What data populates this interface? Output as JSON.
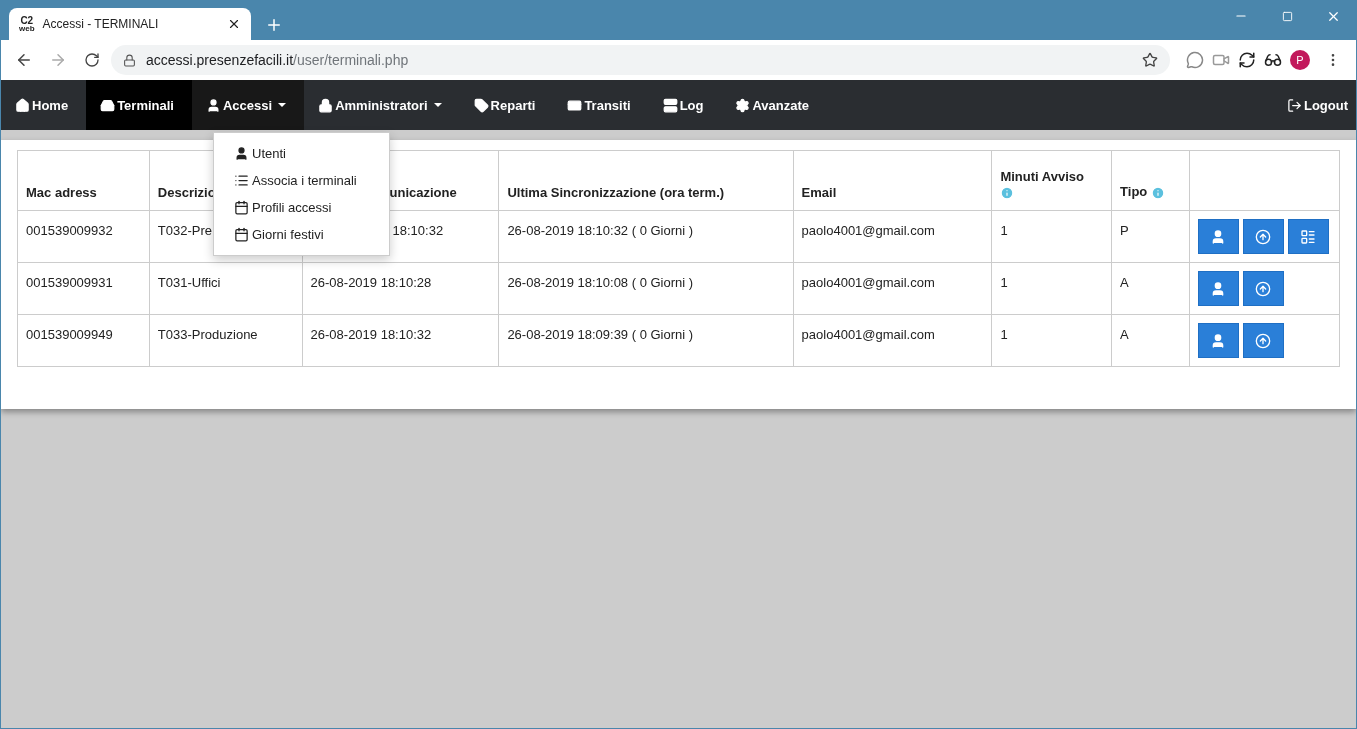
{
  "browser": {
    "tab_title": "Accessi - TERMINALI",
    "tab_logo": "C2",
    "tab_logo_sub": "web",
    "url_host": "accessi.presenzefacili.it",
    "url_path": "/user/terminali.php",
    "profile": "P"
  },
  "nav": {
    "items": [
      {
        "label": "Home",
        "selected": false,
        "expanded": false,
        "dropdown": false
      },
      {
        "label": "Terminali",
        "selected": true,
        "expanded": false,
        "dropdown": false
      },
      {
        "label": "Accessi",
        "selected": false,
        "expanded": true,
        "dropdown": true
      },
      {
        "label": "Amministratori",
        "selected": false,
        "expanded": false,
        "dropdown": true
      },
      {
        "label": "Reparti",
        "selected": false,
        "expanded": false,
        "dropdown": false
      },
      {
        "label": "Transiti",
        "selected": false,
        "expanded": false,
        "dropdown": false
      },
      {
        "label": "Log",
        "selected": false,
        "expanded": false,
        "dropdown": false
      },
      {
        "label": "Avanzate",
        "selected": false,
        "expanded": false,
        "dropdown": false
      }
    ],
    "logout": "Logout"
  },
  "menu": [
    {
      "label": "Utenti"
    },
    {
      "label": "Associa i terminali"
    },
    {
      "label": "Profili accessi"
    },
    {
      "label": "Giorni festivi"
    }
  ],
  "table": {
    "columns": [
      {
        "label": "Mac adress",
        "info": false
      },
      {
        "label": "Descrizio",
        "info": false
      },
      {
        "label": "unicazione",
        "info": false
      },
      {
        "label": "Ultima Sincronizzazione (ora term.)",
        "info": false
      },
      {
        "label": "Email",
        "info": false
      },
      {
        "label": "Minuti Avviso",
        "info": true
      },
      {
        "label": "Tipo",
        "info": true
      }
    ],
    "rows": [
      {
        "cells": [
          "001539009932",
          "T032-Pre",
          "18:10:32",
          "26-08-2019 18:10:32 ( 0 Giorni )",
          "paolo4001@gmail.com",
          "1",
          "P"
        ],
        "actions": [
          {
            "kind": "user"
          },
          {
            "kind": "upload"
          },
          {
            "kind": "list"
          }
        ]
      },
      {
        "cells": [
          "001539009931",
          "T031-Uffici",
          "26-08-2019 18:10:28",
          "26-08-2019 18:10:08 ( 0 Giorni )",
          "paolo4001@gmail.com",
          "1",
          "A"
        ],
        "actions": [
          {
            "kind": "user"
          },
          {
            "kind": "upload"
          }
        ]
      },
      {
        "cells": [
          "001539009949",
          "T033-Produzione",
          "26-08-2019 18:10:32",
          "26-08-2019 18:09:39 ( 0 Giorni )",
          "paolo4001@gmail.com",
          "1",
          "A"
        ],
        "actions": [
          {
            "kind": "user"
          },
          {
            "kind": "upload"
          }
        ]
      }
    ]
  }
}
